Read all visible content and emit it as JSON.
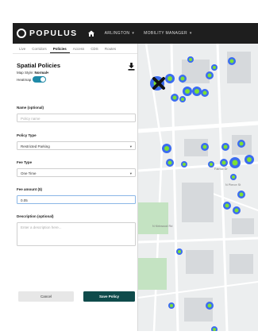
{
  "topbar": {
    "logo_text": "POPULUS",
    "nav": [
      {
        "label": "ARLINGTON"
      },
      {
        "label": "MOBILITY MANAGER"
      }
    ]
  },
  "tabs": [
    "Live",
    "Corridors",
    "Policies",
    "Access",
    "CDS",
    "Routes"
  ],
  "panel": {
    "title": "Spatial Policies",
    "map_style_label": "Map Style:",
    "map_style_value": "Normal",
    "heatmap_label": "Heatmap",
    "heatmap_on": true,
    "name_label": "Name (optional)",
    "name_placeholder": "Policy name",
    "policy_type_label": "Policy Type",
    "policy_type_value": "Restricted Parking",
    "fee_type_label": "Fee Type",
    "fee_type_value": "One Time",
    "fee_amount_label": "Fee amount ($)",
    "fee_amount_value": "0.05",
    "description_label": "Description (optional)",
    "description_placeholder": "Enter a description here...",
    "cancel_label": "Cancel",
    "save_label": "Save Policy"
  },
  "map": {
    "street_labels": [
      "Fairfax Dr",
      "N Kirkwood Rd",
      "N Pierce St"
    ]
  },
  "colors": {
    "accent": "#0f4b4b",
    "toggle": "#1f8aa8",
    "heat_blue": "#3b6cf0",
    "heat_green": "#7de033"
  }
}
